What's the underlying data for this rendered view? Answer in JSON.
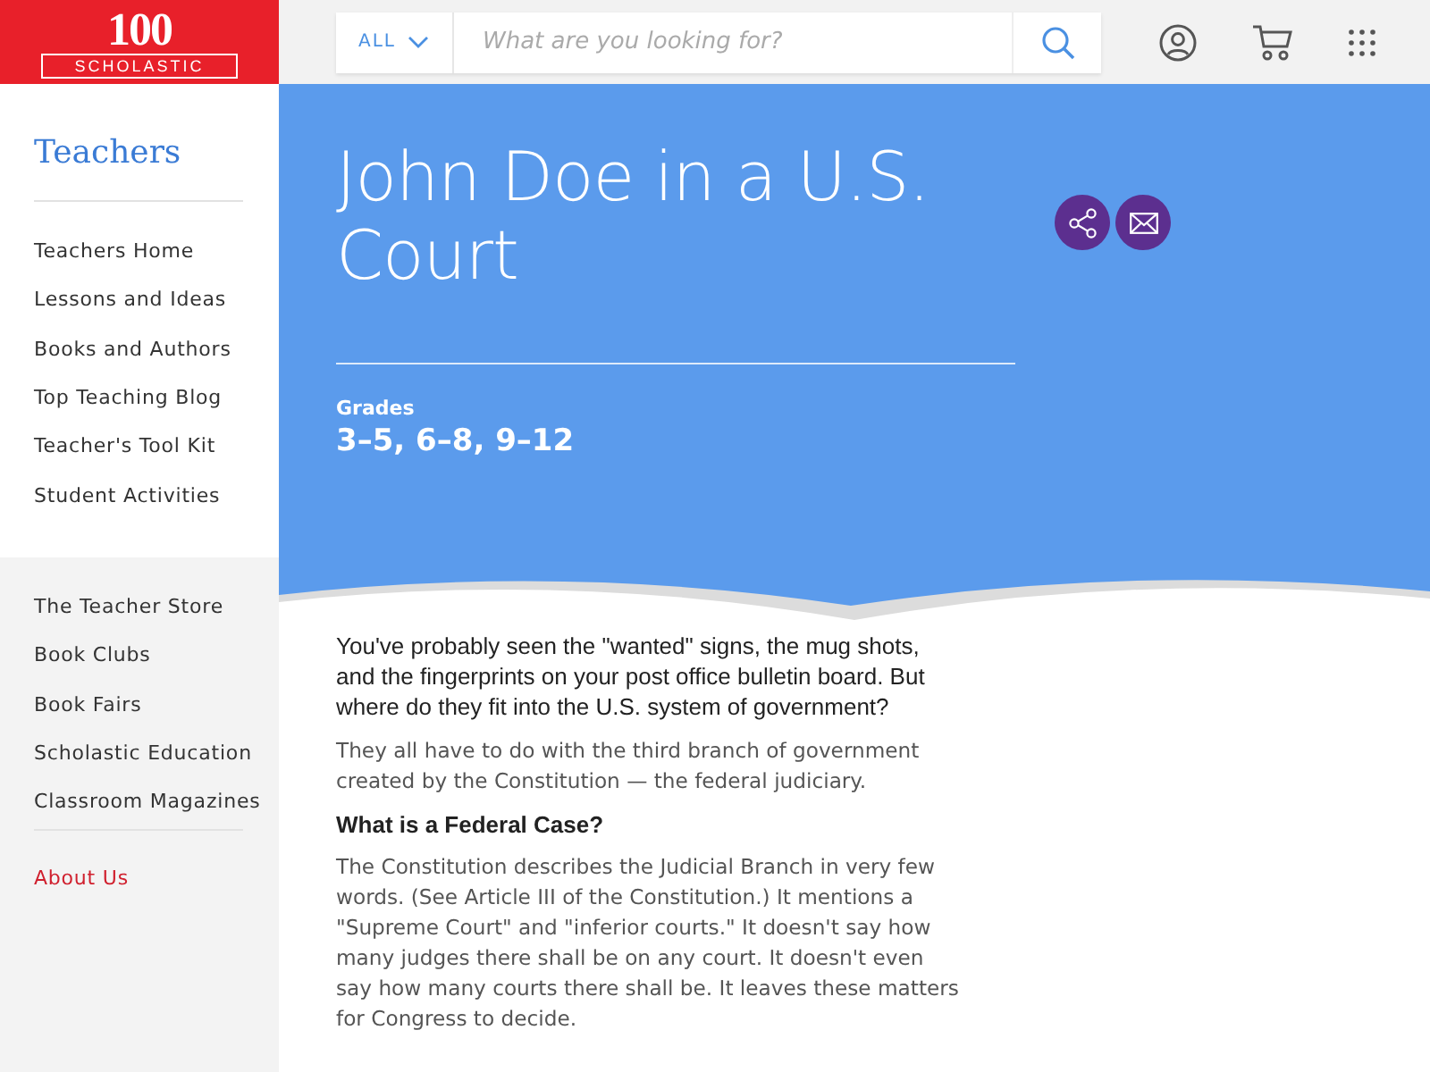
{
  "logo": {
    "number": "100",
    "wordmark": "SCHOLASTIC"
  },
  "search": {
    "scope": "ALL",
    "placeholder": "What are you looking for?"
  },
  "sidebar": {
    "title": "Teachers",
    "primary_links": [
      "Teachers Home",
      "Lessons and Ideas",
      "Books and Authors",
      "Top Teaching Blog",
      "Teacher's Tool Kit",
      "Student Activities"
    ],
    "secondary_links": [
      "The Teacher Store",
      "Book Clubs",
      "Book Fairs",
      "Scholastic Education",
      "Classroom Magazines"
    ],
    "about_link": "About Us"
  },
  "hero": {
    "title": "John Doe in a U.S. Court",
    "grades_label": "Grades",
    "grades": "3–5, 6–8, 9–12"
  },
  "article": [
    {
      "kind": "lead",
      "text": "You've probably seen the \"wanted\" signs, the mug shots, and the fingerprints on your post office bulletin board. But where do they fit into the U.S. system of government?"
    },
    {
      "kind": "body",
      "text": "They all have to do with the third branch of government created by the Constitution — the federal judiciary."
    },
    {
      "kind": "heading",
      "text": "What is a Federal Case?"
    },
    {
      "kind": "body",
      "text": "The Constitution describes the Judicial Branch in very few words. (See Article III of the Constitution.) It mentions a \"Supreme Court\" and \"inferior courts.\" It doesn't say how many judges there shall be on any court. It doesn't even say how many courts there shall be. It leaves these matters for Congress to decide."
    }
  ]
}
